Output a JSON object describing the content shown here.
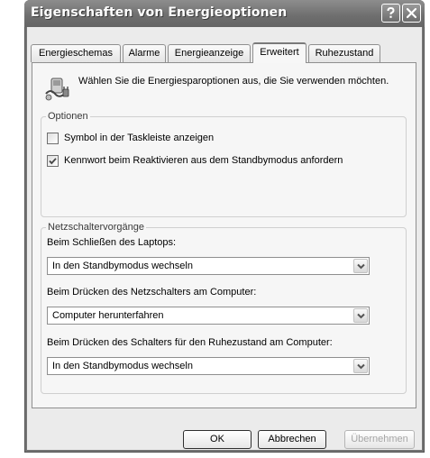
{
  "window": {
    "title": "Eigenschaften von Energieoptionen",
    "help_label": "?",
    "close_label": "Schließen"
  },
  "tabs": [
    {
      "label": "Energieschemas"
    },
    {
      "label": "Alarme"
    },
    {
      "label": "Energieanzeige"
    },
    {
      "label": "Erweitert",
      "active": true
    },
    {
      "label": "Ruhezustand"
    }
  ],
  "header": {
    "text": "Wählen Sie die Energiesparoptionen aus, die Sie verwenden möchten.",
    "icon": "power-options-icon"
  },
  "options": {
    "legend": "Optionen",
    "checkboxes": [
      {
        "label": "Symbol in der Taskleiste anzeigen",
        "checked": false
      },
      {
        "label": "Kennwort beim Reaktivieren aus dem Standbymodus anfordern",
        "checked": true
      }
    ]
  },
  "power_buttons": {
    "legend": "Netzschaltervorgänge",
    "fields": [
      {
        "label": "Beim Schließen des Laptops:",
        "value": "In den Standbymodus wechseln"
      },
      {
        "label": "Beim Drücken des Netzschalters am Computer:",
        "value": "Computer herunterfahren"
      },
      {
        "label": "Beim Drücken des Schalters für den Ruhezustand am Computer:",
        "value": "In den Standbymodus wechseln"
      }
    ]
  },
  "buttons": {
    "ok": "OK",
    "cancel": "Abbrechen",
    "apply": "Übernehmen"
  },
  "colors": {
    "titlebar": "#737373",
    "dialog_face": "#ebebeb",
    "panel": "#f6f6f6"
  }
}
